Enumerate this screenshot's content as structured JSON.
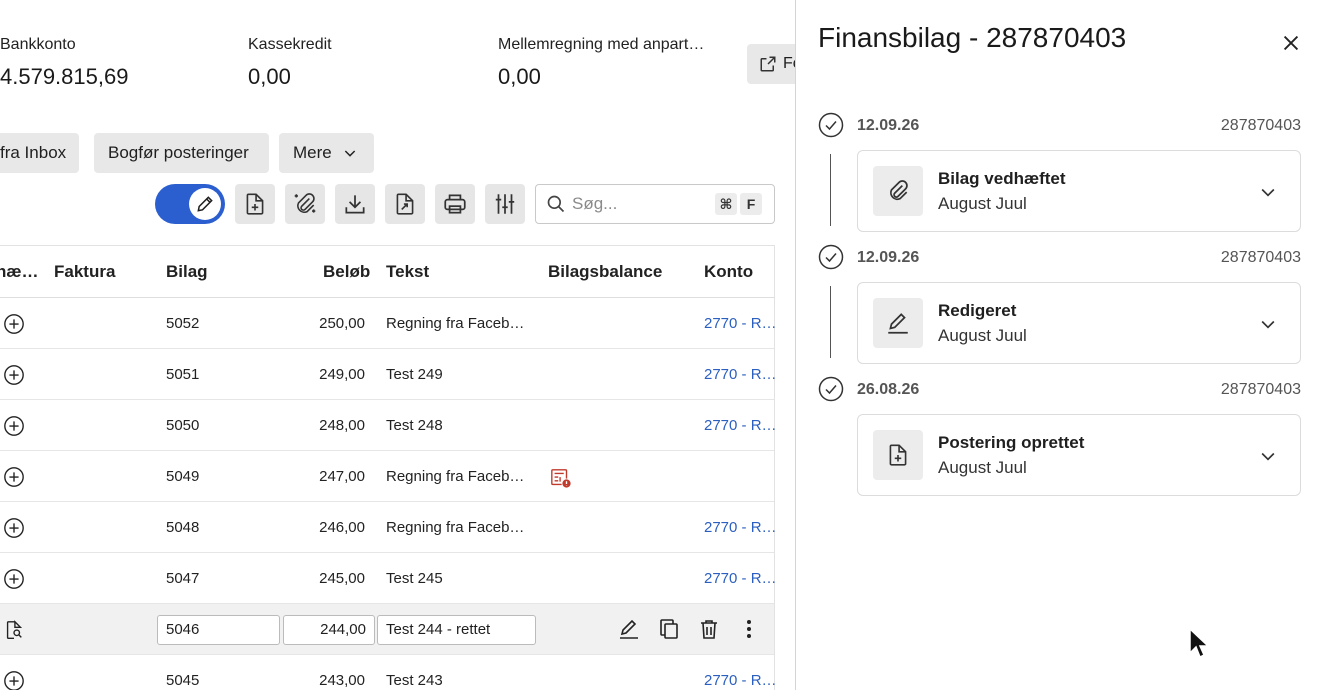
{
  "summary": [
    {
      "label": "Bankkonto",
      "value": "4.579.815,69"
    },
    {
      "label": "Kassekredit",
      "value": "0,00"
    },
    {
      "label": "Mellemregning med anpart…",
      "value": "0,00"
    }
  ],
  "external_button_label": "Fo",
  "actions": {
    "inbox_label": "fra Inbox",
    "post_label": "Bogfør posteringer",
    "more_label": "Mere"
  },
  "search": {
    "placeholder": "Søg...",
    "shortcut_mod": "⌘",
    "shortcut_key": "F"
  },
  "table": {
    "headers": {
      "first": "næ…",
      "invoice": "Faktura",
      "voucher": "Bilag",
      "amount": "Beløb",
      "text": "Tekst",
      "balance": "Bilagsbalance",
      "account": "Konto"
    },
    "rows": [
      {
        "voucher": "5052",
        "amount": "250,00",
        "text": "Regning fra Faceb…",
        "account": "2770 - R…"
      },
      {
        "voucher": "5051",
        "amount": "249,00",
        "text": "Test 249",
        "account": "2770 - R…"
      },
      {
        "voucher": "5050",
        "amount": "248,00",
        "text": "Test 248",
        "account": "2770 - R…"
      },
      {
        "voucher": "5049",
        "amount": "247,00",
        "text": "Regning fra Faceb…",
        "account": ""
      },
      {
        "voucher": "5048",
        "amount": "246,00",
        "text": "Regning fra Faceb…",
        "account": "2770 - R…"
      },
      {
        "voucher": "5047",
        "amount": "245,00",
        "text": "Test 245",
        "account": "2770 - R…"
      }
    ],
    "editing_row": {
      "voucher": "5046",
      "amount": "244,00",
      "text": "Test 244 - rettet"
    },
    "last_row": {
      "voucher": "5045",
      "amount": "243,00",
      "text": "Test 243",
      "account": "2770 - R…"
    }
  },
  "panel": {
    "title": "Finansbilag - 287870403",
    "events": [
      {
        "date": "12.09.26",
        "id": "287870403",
        "title": "Bilag vedhæftet",
        "user": "August Juul",
        "icon": "paperclip-icon"
      },
      {
        "date": "12.09.26",
        "id": "287870403",
        "title": "Redigeret",
        "user": "August Juul",
        "icon": "pencil-icon"
      },
      {
        "date": "26.08.26",
        "id": "287870403",
        "title": "Postering oprettet",
        "user": "August Juul",
        "icon": "file-plus-icon"
      }
    ]
  },
  "colors": {
    "accent": "#2b5fd0",
    "link": "#2b5fc0",
    "warning": "#c0392b",
    "button_bg": "#e8e8e8"
  }
}
